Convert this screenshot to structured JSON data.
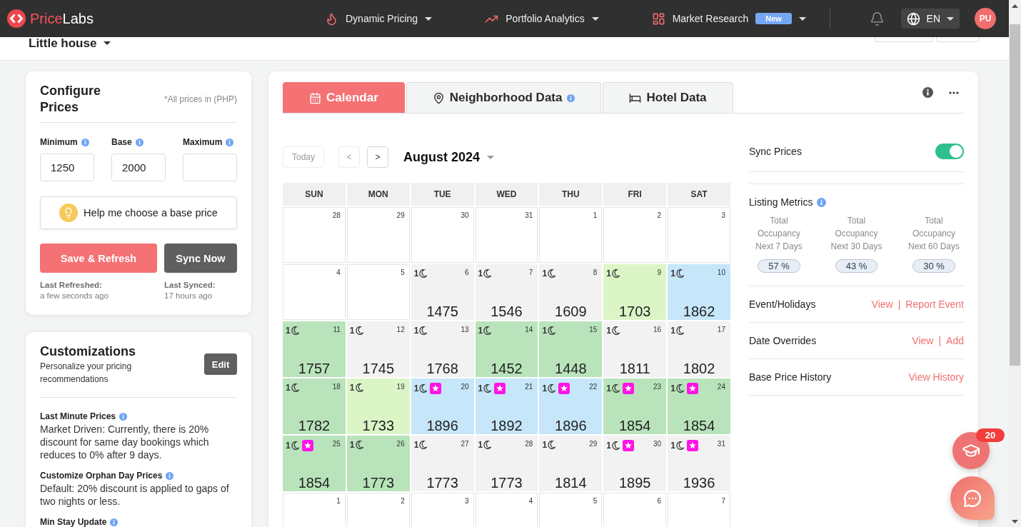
{
  "nav": {
    "brand": {
      "accent": "Price",
      "rest": "Labs"
    },
    "menus": [
      {
        "kind": "flame",
        "label": "Dynamic Pricing"
      },
      {
        "kind": "trend",
        "label": "Portfolio Analytics"
      },
      {
        "kind": "dashboard",
        "label": "Market Research",
        "badge": "New"
      }
    ],
    "language": "EN",
    "avatar": "PU"
  },
  "listing": {
    "name": "Little house"
  },
  "configure": {
    "title": "Configure Prices",
    "note": "*All prices in (PHP)",
    "fields": [
      {
        "label": "Minimum",
        "value": "1250"
      },
      {
        "label": "Base",
        "value": "2000"
      },
      {
        "label": "Maximum"
      }
    ],
    "help_button": "Help me choose a base price",
    "buttons": [
      {
        "kind": "primary",
        "label": "Save & Refresh"
      },
      {
        "kind": "secondary",
        "label": "Sync Now"
      }
    ],
    "statuses": [
      {
        "label": "Last Refreshed:",
        "value": "a few seconds ago"
      },
      {
        "label": "Last Synced:",
        "value": "17 hours ago"
      }
    ]
  },
  "customizations": {
    "title": "Customizations",
    "subtitle": "Personalize your pricing recommendations",
    "edit_button": "Edit",
    "settings": [
      {
        "label": "Last Minute Prices",
        "text": "Market Driven: Currently, there is 20% discount for same day bookings which reduces to 0% after 9 days."
      },
      {
        "label": "Customize Orphan Day Prices",
        "text": "Default: 20% discount is applied to gaps of two nights or less."
      },
      {
        "label": "Min Stay Update"
      }
    ]
  },
  "tabs": [
    {
      "kind": "calendar",
      "label": "Calendar",
      "selected": true,
      "info": false
    },
    {
      "kind": "pin",
      "label": "Neighborhood Data",
      "selected": false,
      "info": true
    },
    {
      "kind": "bed",
      "label": "Hotel Data",
      "selected": false,
      "info": false
    }
  ],
  "calendar": {
    "nav_buttons": [
      {
        "kind": "today",
        "label": "Today",
        "disabled": true
      },
      {
        "kind": "prev",
        "label": "<",
        "disabled": true
      },
      {
        "kind": "next",
        "label": ">",
        "disabled": false
      }
    ],
    "month": "August 2024",
    "weekdays": [
      "SUN",
      "MON",
      "TUE",
      "WED",
      "THU",
      "FRI",
      "SAT"
    ],
    "weeks": [
      [
        {
          "kind": "blank",
          "day": "28"
        },
        {
          "kind": "blank",
          "day": "29"
        },
        {
          "kind": "blank",
          "day": "30"
        },
        {
          "kind": "blank",
          "day": "31"
        },
        {
          "kind": "blank",
          "day": "1"
        },
        {
          "kind": "blank",
          "day": "2"
        },
        {
          "kind": "blank",
          "day": "3"
        }
      ],
      [
        {
          "kind": "blank",
          "day": "4"
        },
        {
          "kind": "blank",
          "day": "5"
        },
        {
          "kind": "priced",
          "day": "6",
          "min_stay": "1",
          "price": "1475",
          "color": "#f2f2f2",
          "event": false
        },
        {
          "kind": "priced",
          "day": "7",
          "min_stay": "1",
          "price": "1546",
          "color": "#f2f2f2",
          "event": false
        },
        {
          "kind": "priced",
          "day": "8",
          "min_stay": "1",
          "price": "1609",
          "color": "#f2f2f2",
          "event": false
        },
        {
          "kind": "priced",
          "day": "9",
          "min_stay": "1",
          "price": "1703",
          "color": "#dcf5c7",
          "event": false
        },
        {
          "kind": "priced",
          "day": "10",
          "min_stay": "1",
          "price": "1862",
          "color": "#c6e6f9",
          "event": false
        }
      ],
      [
        {
          "kind": "priced",
          "day": "11",
          "min_stay": "1",
          "price": "1757",
          "color": "#b9e4bb",
          "event": false
        },
        {
          "kind": "priced",
          "day": "12",
          "min_stay": "1",
          "price": "1745",
          "color": "#f2f2f2",
          "event": false
        },
        {
          "kind": "priced",
          "day": "13",
          "min_stay": "1",
          "price": "1768",
          "color": "#f2f2f2",
          "event": false
        },
        {
          "kind": "priced",
          "day": "14",
          "min_stay": "1",
          "price": "1452",
          "color": "#b9e4bb",
          "event": false
        },
        {
          "kind": "priced",
          "day": "15",
          "min_stay": "1",
          "price": "1448",
          "color": "#b9e4bb",
          "event": false
        },
        {
          "kind": "priced",
          "day": "16",
          "min_stay": "1",
          "price": "1811",
          "color": "#f2f2f2",
          "event": false
        },
        {
          "kind": "priced",
          "day": "17",
          "min_stay": "1",
          "price": "1802",
          "color": "#f2f2f2",
          "event": false
        }
      ],
      [
        {
          "kind": "priced",
          "day": "18",
          "min_stay": "1",
          "price": "1782",
          "color": "#b9e4bb",
          "event": false
        },
        {
          "kind": "priced",
          "day": "19",
          "min_stay": "1",
          "price": "1733",
          "color": "#dcf5c7",
          "event": false
        },
        {
          "kind": "priced",
          "day": "20",
          "min_stay": "1",
          "price": "1896",
          "color": "#c6e6f9",
          "event": true
        },
        {
          "kind": "priced",
          "day": "21",
          "min_stay": "1",
          "price": "1892",
          "color": "#c6e6f9",
          "event": true
        },
        {
          "kind": "priced",
          "day": "22",
          "min_stay": "1",
          "price": "1896",
          "color": "#c6e6f9",
          "event": true
        },
        {
          "kind": "priced",
          "day": "23",
          "min_stay": "1",
          "price": "1854",
          "color": "#b9e4bb",
          "event": true
        },
        {
          "kind": "priced",
          "day": "24",
          "min_stay": "1",
          "price": "1854",
          "color": "#b9e4bb",
          "event": true
        }
      ],
      [
        {
          "kind": "priced",
          "day": "25",
          "min_stay": "1",
          "price": "1854",
          "color": "#b9e4bb",
          "event": true
        },
        {
          "kind": "priced",
          "day": "26",
          "min_stay": "1",
          "price": "1773",
          "color": "#b9e4bb",
          "event": false
        },
        {
          "kind": "priced",
          "day": "27",
          "min_stay": "1",
          "price": "1773",
          "color": "#f2f2f2",
          "event": false
        },
        {
          "kind": "priced",
          "day": "28",
          "min_stay": "1",
          "price": "1773",
          "color": "#f2f2f2",
          "event": false
        },
        {
          "kind": "priced",
          "day": "29",
          "min_stay": "1",
          "price": "1814",
          "color": "#f2f2f2",
          "event": false
        },
        {
          "kind": "priced",
          "day": "30",
          "min_stay": "1",
          "price": "1895",
          "color": "#f2f2f2",
          "event": true
        },
        {
          "kind": "priced",
          "day": "31",
          "min_stay": "1",
          "price": "1936",
          "color": "#f2f2f2",
          "event": true
        }
      ],
      [
        {
          "kind": "blank",
          "day": "1"
        },
        {
          "kind": "blank",
          "day": "2"
        },
        {
          "kind": "blank",
          "day": "3"
        },
        {
          "kind": "blank",
          "day": "4"
        },
        {
          "kind": "blank",
          "day": "5"
        },
        {
          "kind": "blank",
          "day": "6"
        },
        {
          "kind": "blank",
          "day": "7"
        }
      ]
    ]
  },
  "side": {
    "sync": {
      "label": "Sync Prices",
      "on": true
    },
    "metrics": {
      "title": "Listing Metrics",
      "items": [
        {
          "label": "Total Occupancy Next 7 Days",
          "value": "57 %"
        },
        {
          "label": "Total Occupancy Next 30 Days",
          "value": "43 %"
        },
        {
          "label": "Total Occupancy Next 60 Days",
          "value": "30 %"
        }
      ]
    },
    "rows": [
      {
        "label": "Event/Holidays",
        "links": [
          "View",
          "Report Event"
        ],
        "separator": "|"
      },
      {
        "label": "Date Overrides",
        "links": [
          "View",
          "Add"
        ],
        "separator": "|"
      },
      {
        "label": "Base Price History",
        "links": [
          "View History"
        ]
      }
    ]
  },
  "widgets": {
    "tutorials_badge": "20"
  }
}
